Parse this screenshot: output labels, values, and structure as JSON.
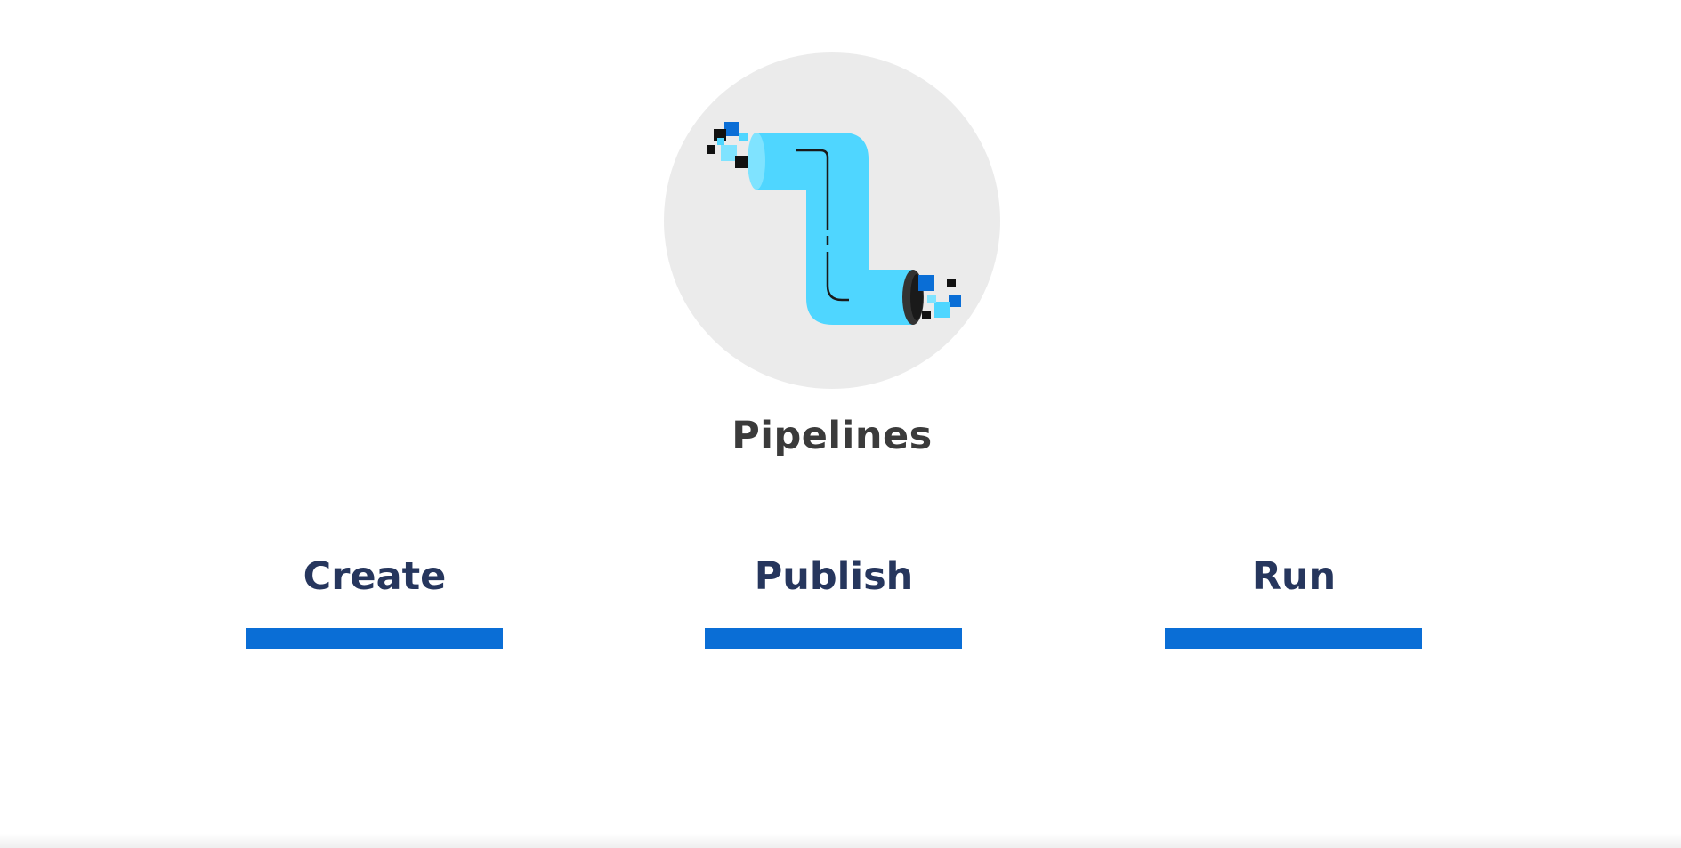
{
  "hero": {
    "icon": "pipeline-icon",
    "title": "Pipelines"
  },
  "steps": [
    {
      "label": "Create"
    },
    {
      "label": "Publish"
    },
    {
      "label": "Run"
    }
  ],
  "colors": {
    "pipe": "#4fd6ff",
    "circle": "#ebebeb",
    "step_bar": "#0a6ed6",
    "step_text": "#26365d",
    "title_text": "#3b3b3b",
    "pixel_dark_blue": "#0a6ed6",
    "pixel_black": "#111111"
  }
}
